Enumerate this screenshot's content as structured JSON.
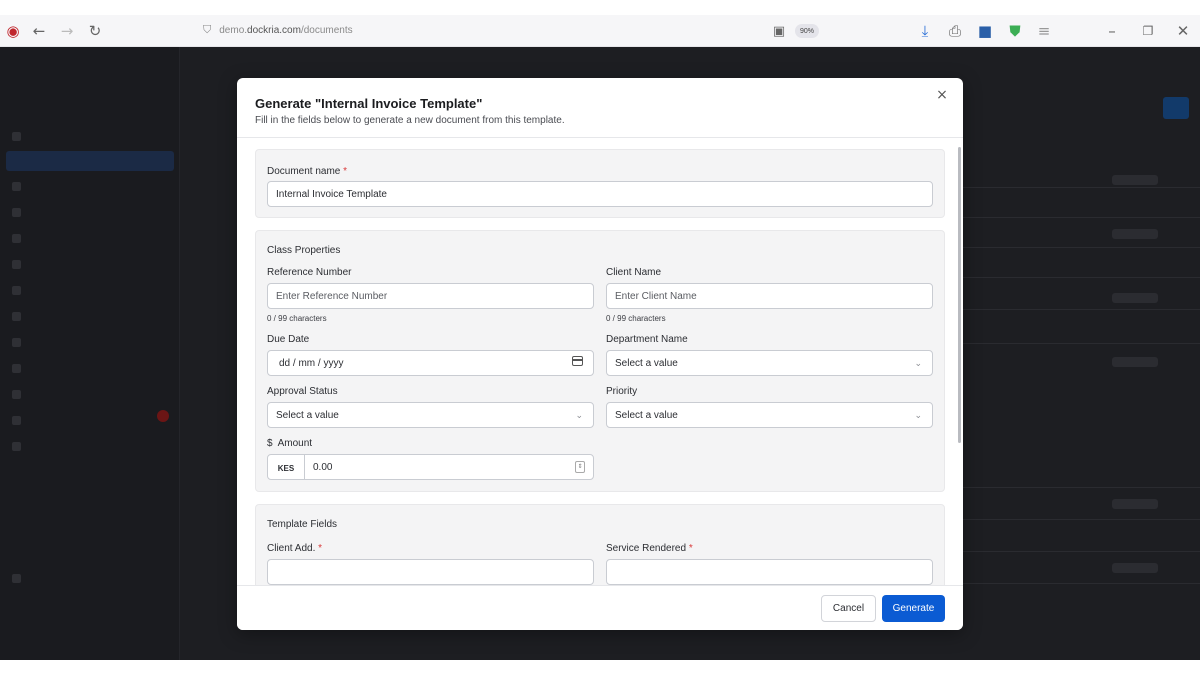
{
  "browser": {
    "url_prefix": "demo.",
    "url_domain": "dockria.com",
    "url_path": "/documents",
    "zoom": "90%",
    "icons": [
      "app-logo-icon",
      "back-icon",
      "forward-icon",
      "reload-icon",
      "shield-icon",
      "reader-icon",
      "download-icon",
      "share-icon",
      "extension-icon",
      "vpn-icon",
      "menu-icon",
      "minimize-icon",
      "restore-icon",
      "close-window-icon"
    ]
  },
  "modal": {
    "title": "Generate \"Internal Invoice Template\"",
    "subtitle": "Fill in the fields below to generate a new document from this template.",
    "close_label": "×",
    "document_name": {
      "label": "Document name",
      "required_mark": "*",
      "value": "Internal Invoice Template"
    },
    "class_properties": {
      "heading": "Class Properties",
      "reference_number": {
        "label": "Reference Number",
        "placeholder": "Enter Reference Number",
        "help": "0 / 99 characters"
      },
      "client_name": {
        "label": "Client Name",
        "placeholder": "Enter Client Name",
        "help": "0 / 99 characters"
      },
      "due_date": {
        "label": "Due Date",
        "placeholder": "dd / mm / yyyy"
      },
      "department_name": {
        "label": "Department Name",
        "value": "Select a value"
      },
      "approval_status": {
        "label": "Approval Status",
        "value": "Select a value"
      },
      "priority": {
        "label": "Priority",
        "value": "Select a value"
      },
      "amount": {
        "label": "Amount",
        "currency_symbol": "$",
        "currency_code": "KES",
        "value": "0.00"
      }
    },
    "template_fields": {
      "heading": "Template Fields",
      "client_add": {
        "label": "Client Add.",
        "required_mark": "*",
        "value": ""
      },
      "service_rendered": {
        "label": "Service Rendered",
        "required_mark": "*",
        "value": ""
      }
    },
    "footer": {
      "cancel_label": "Cancel",
      "generate_label": "Generate"
    }
  },
  "colors": {
    "primary": "#0b5bd3",
    "required": "#d93a3a",
    "backdrop": "#1d1e22"
  }
}
